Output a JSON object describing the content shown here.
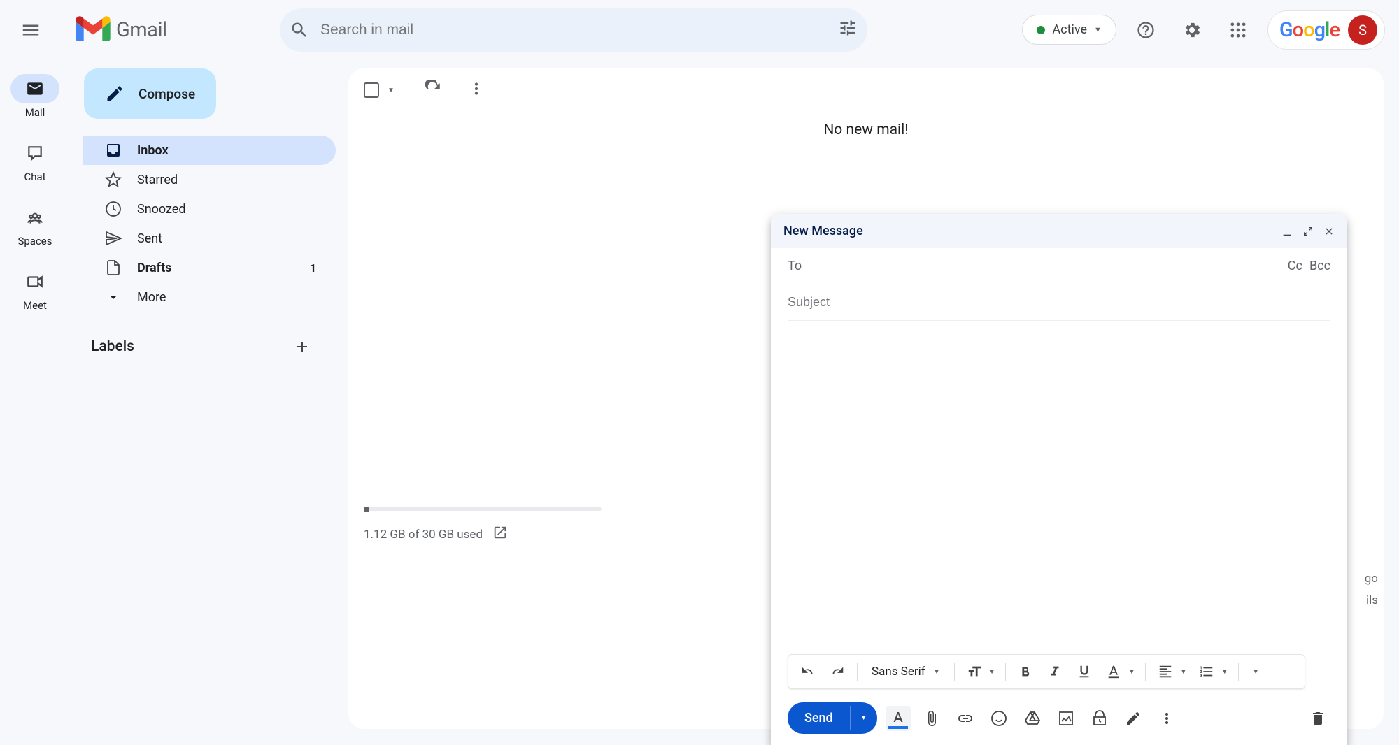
{
  "header": {
    "product_name": "Gmail",
    "search_placeholder": "Search in mail",
    "status_chip": "Active",
    "avatar_initial": "S"
  },
  "rail": {
    "items": [
      {
        "label": "Mail",
        "active": true
      },
      {
        "label": "Chat",
        "active": false
      },
      {
        "label": "Spaces",
        "active": false
      },
      {
        "label": "Meet",
        "active": false
      }
    ]
  },
  "sidebar": {
    "compose_label": "Compose",
    "nav": [
      {
        "label": "Inbox",
        "active": true,
        "bold": true
      },
      {
        "label": "Starred"
      },
      {
        "label": "Snoozed"
      },
      {
        "label": "Sent"
      },
      {
        "label": "Drafts",
        "bold": true,
        "count": "1"
      },
      {
        "label": "More"
      }
    ],
    "labels_heading": "Labels"
  },
  "main": {
    "empty_text": "No new mail!",
    "storage_text": "1.12 GB of 30 GB used",
    "footer_line1": "go",
    "footer_line2": "ils"
  },
  "compose": {
    "title": "New Message",
    "to_label": "To",
    "cc_label": "Cc",
    "bcc_label": "Bcc",
    "subject_placeholder": "Subject",
    "font_name": "Sans Serif",
    "send_label": "Send"
  }
}
